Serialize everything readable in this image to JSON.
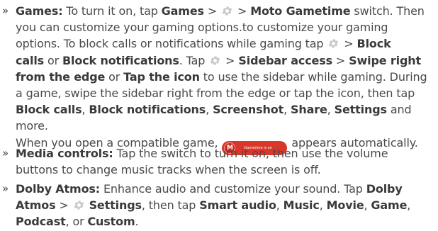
{
  "bullet_glyph": "»",
  "colors": {
    "text": "#4a4a4a",
    "icon_gray": "#c9c9c9",
    "pill_red": "#d8372a"
  },
  "icons": {
    "settings": "gear-icon",
    "moto": "moto-logo-icon"
  },
  "games": {
    "label": "Games:",
    "l1_a": " To turn it on, tap ",
    "l1_games": "Games",
    "sep": " > ",
    "l1_moto": "Moto Gametime",
    "l1_b": " switch. Then",
    "l2": "you can customize your gaming options.to customize your gaming",
    "l3_a": "options. To block calls or notifications while gaming tap ",
    "l3_b": " > ",
    "l3_block": "Block",
    "l4_calls": "calls",
    "l4_or": " or ",
    "l4_blocknotif": "Block notifications",
    "l4_tap": ". Tap ",
    "l4_sep": " > ",
    "l4_sidebar": "Sidebar access",
    "l4_sep2": " > ",
    "l4_swipe": "Swipe right",
    "l5_from": "from the edge",
    "l5_or": " or ",
    "l5_tapicon": "Tap the icon",
    "l5_rest": " to use the sidebar while gaming. During",
    "l6": "a game, swipe the sidebar right from the edge or tap the icon, then tap",
    "l7_calls": "Block calls",
    "l7_c1": ", ",
    "l7_notif": "Block notifications",
    "l7_c2": ", ",
    "l7_screenshot": "Screenshot",
    "l7_c3": ", ",
    "l7_share": "Share",
    "l7_c4": ", ",
    "l7_settings": "Settings",
    "l7_end": " and more.",
    "l8_a": "When you open a compatible game, ",
    "l8_badge": "Gametime is on",
    "l8_b": " appears automatically."
  },
  "media": {
    "label": "Media controls:",
    "l1": " Tap the switch to turn it on, then use the volume",
    "l2": "buttons to change music tracks when the screen is off."
  },
  "dolby": {
    "label": "Dolby Atmos:",
    "l1_a": " Enhance audio and customize your sound. Tap ",
    "l1_dolby": "Dolby",
    "l2_atmos": "Atmos",
    "l2_sep": " > ",
    "l2_settings": "Settings",
    "l2_then": ", then tap ",
    "l2_smart": "Smart audio",
    "l2_c1": ", ",
    "l2_music": "Music",
    "l2_c2": ", ",
    "l2_movie": "Movie",
    "l2_c3": ", ",
    "l2_game": "Game",
    "l2_c4": ",",
    "l3_podcast": "Podcast",
    "l3_or": ", or ",
    "l3_custom": "Custom",
    "l3_end": "."
  }
}
